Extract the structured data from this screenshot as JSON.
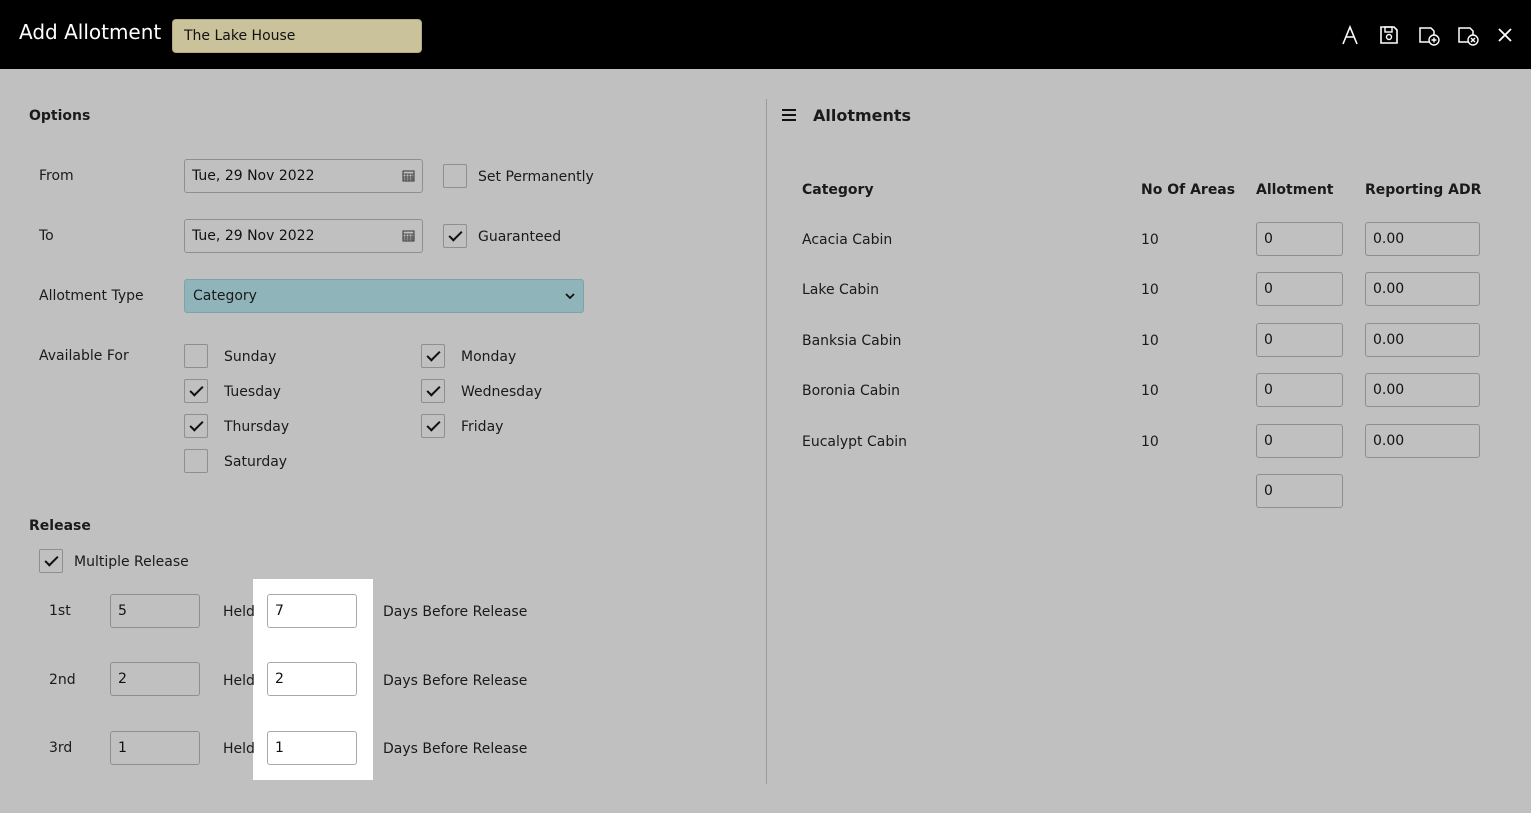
{
  "header": {
    "title": "Add Allotment",
    "property": "The Lake House",
    "icons": [
      "font-icon",
      "save-icon",
      "save-new-icon",
      "save-close-icon",
      "close-icon"
    ]
  },
  "options": {
    "title": "Options",
    "from_label": "From",
    "from_value": "Tue, 29 Nov 2022",
    "to_label": "To",
    "to_value": "Tue, 29 Nov 2022",
    "set_permanently_label": "Set Permanently",
    "set_permanently": false,
    "guaranteed_label": "Guaranteed",
    "guaranteed": true,
    "allotment_type_label": "Allotment Type",
    "allotment_type_value": "Category",
    "available_for_label": "Available For",
    "days": [
      {
        "label": "Sunday",
        "checked": false
      },
      {
        "label": "Monday",
        "checked": true
      },
      {
        "label": "Tuesday",
        "checked": true
      },
      {
        "label": "Wednesday",
        "checked": true
      },
      {
        "label": "Thursday",
        "checked": true
      },
      {
        "label": "Friday",
        "checked": true
      },
      {
        "label": "Saturday",
        "checked": false
      }
    ]
  },
  "release": {
    "title": "Release",
    "multiple_release_label": "Multiple Release",
    "multiple_release": true,
    "held_label": "Held",
    "days_before_label": "Days Before Release",
    "rows": [
      {
        "ordinal": "1st",
        "held": "5",
        "days": "7"
      },
      {
        "ordinal": "2nd",
        "held": "2",
        "days": "2"
      },
      {
        "ordinal": "3rd",
        "held": "1",
        "days": "1"
      }
    ]
  },
  "allotments": {
    "title": "Allotments",
    "columns": [
      "Category",
      "No Of Areas",
      "Allotment",
      "Reporting ADR"
    ],
    "rows": [
      {
        "category": "Acacia Cabin",
        "areas": "10",
        "allotment": "0",
        "adr": "0.00"
      },
      {
        "category": "Lake Cabin",
        "areas": "10",
        "allotment": "0",
        "adr": "0.00"
      },
      {
        "category": "Banksia Cabin",
        "areas": "10",
        "allotment": "0",
        "adr": "0.00"
      },
      {
        "category": "Boronia Cabin",
        "areas": "10",
        "allotment": "0",
        "adr": "0.00"
      },
      {
        "category": "Eucalypt Cabin",
        "areas": "10",
        "allotment": "0",
        "adr": "0.00"
      }
    ],
    "total_allotment": "0"
  }
}
